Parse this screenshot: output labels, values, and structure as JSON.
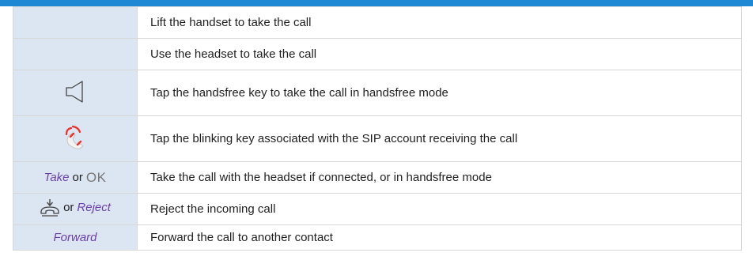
{
  "rows": [
    {
      "icon": "",
      "description": "Lift the handset to take the call"
    },
    {
      "icon": "",
      "description": "Use the headset to take the call"
    },
    {
      "icon": "speaker-icon",
      "description": "Tap the handsfree key to take the call in handsfree mode"
    },
    {
      "icon": "ringing-phone-icon",
      "description": "Tap the blinking key associated with the SIP account receiving the call"
    },
    {
      "action": {
        "key1": "Take",
        "joiner": "or",
        "key2": "OK"
      },
      "description": "Take the call with the headset if connected, or in handsfree mode"
    },
    {
      "action": {
        "icon": "reject-handset-icon",
        "joiner": "or",
        "key": "Reject"
      },
      "description": "Reject the incoming call"
    },
    {
      "action": {
        "key": "Forward"
      },
      "description": "Forward the call to another contact"
    }
  ],
  "colors": {
    "accent_bar": "#1e88d4",
    "icon_cell_bg": "#dce6f2",
    "italic_key": "#6b3fa6",
    "ok_key": "#777777",
    "ring_red": "#e8312a"
  }
}
